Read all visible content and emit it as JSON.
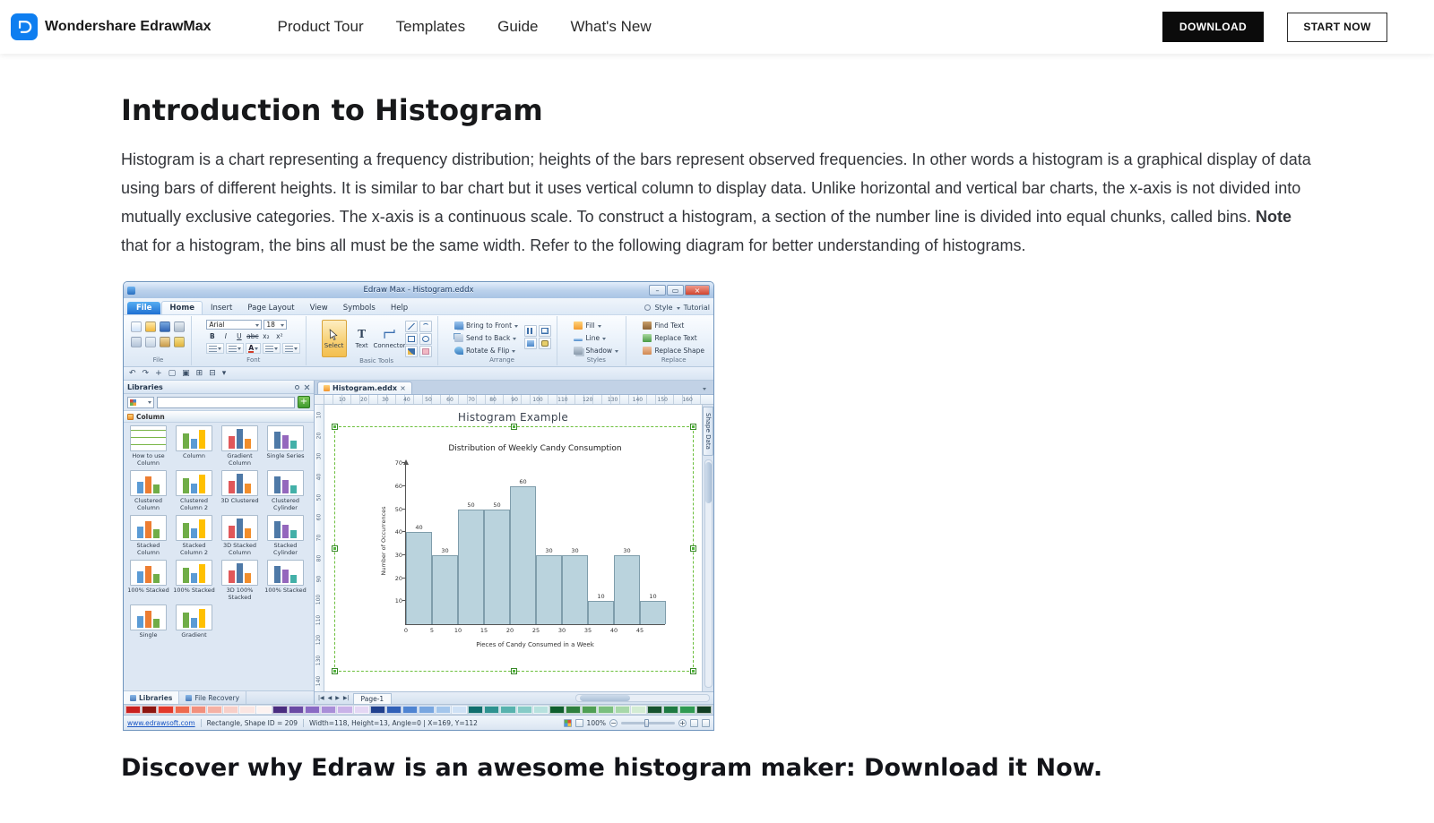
{
  "nav": {
    "brand": "Wondershare EdrawMax",
    "links": [
      "Product Tour",
      "Templates",
      "Guide",
      "What's New"
    ],
    "download_label": "DOWNLOAD",
    "start_label": "START NOW"
  },
  "article": {
    "title": "Introduction to Histogram",
    "p1": "Histogram is a chart representing a frequency distribution; heights of the bars represent observed frequencies. In other words a histogram is a graphical display of data using bars of different heights. It is similar to bar chart but it uses vertical column to display data. Unlike horizontal and vertical bar charts, the x-axis is not divided into mutually exclusive categories. The x-axis is a continuous scale. To construct a histogram, a section of the number line is divided into equal chunks, called bins. ",
    "note": "Note",
    "p2": " that for a histogram, the bins all must be the same width. Refer to the following diagram for better understanding of histograms.",
    "closing": "Discover why Edraw is an awesome histogram maker: Download it Now."
  },
  "app": {
    "window_title": "Edraw Max - Histogram.eddx",
    "window_controls": [
      "–",
      "▭",
      "×"
    ],
    "ribbon": {
      "tabs": [
        "File",
        "Home",
        "Insert",
        "Page Layout",
        "View",
        "Symbols",
        "Help"
      ],
      "active_tab": "Home",
      "right": [
        "Style",
        "Tutorial"
      ],
      "group_labels": [
        "File",
        "Font",
        "Basic Tools",
        "Arrange",
        "Styles",
        "Replace"
      ],
      "font_name": "Arial",
      "font_size": "18",
      "font_buttons": [
        "B",
        "I",
        "U",
        "abc",
        "x₂",
        "x²"
      ],
      "basic_tools": [
        "Select",
        "Text",
        "Connector"
      ],
      "text_tool_glyph": "T",
      "arrange_items": [
        "Bring to Front",
        "Send to Back",
        "Rotate & Flip"
      ],
      "style_items": [
        "Fill",
        "Line",
        "Shadow"
      ],
      "replace_items": [
        "Find Text",
        "Replace Text",
        "Replace Shape"
      ],
      "file_icons": [
        "new-icon",
        "open-icon",
        "save-icon",
        "print-icon",
        "cut-icon",
        "copy-icon",
        "paste-icon",
        "format-painter-icon"
      ],
      "font_row3_icons": [
        "numbered-list-icon",
        "highlight-icon",
        "font-color-icon",
        "align-text-icon",
        "bullet-list-icon"
      ],
      "basic_mini_icons": [
        "line-tool-icon",
        "curve-tool-icon",
        "rectangle-tool-icon",
        "ellipse-tool-icon",
        "pen-tool-icon",
        "eraser-tool-icon"
      ],
      "arrange_extra_icons": [
        "align-shapes-icon",
        "group-shapes-icon",
        "layer-icon",
        "lock-shape-icon"
      ]
    },
    "qat_icons": [
      {
        "name": "undo-icon",
        "glyph": "↶"
      },
      {
        "name": "redo-icon",
        "glyph": "↷"
      },
      {
        "name": "add-page-icon",
        "glyph": "+"
      },
      {
        "name": "page-icon",
        "glyph": "▢"
      },
      {
        "name": "duplicate-page-icon",
        "glyph": "▣"
      },
      {
        "name": "grid-icon",
        "glyph": "⊞"
      },
      {
        "name": "snap-icon",
        "glyph": "⊟"
      },
      {
        "name": "more-tools-icon",
        "glyph": "▾"
      }
    ],
    "left_panel": {
      "title": "Libraries",
      "section": "Column",
      "items": [
        "How to use Column",
        "Column",
        "Gradient Column",
        "Single Series",
        "Clustered Column",
        "Clustered Column 2",
        "3D Clustered",
        "Clustered Cylinder",
        "Stacked Column",
        "Stacked Column 2",
        "3D Stacked Column",
        "Stacked Cylinder",
        "100% Stacked",
        "100% Stacked",
        "3D 100% Stacked",
        "100% Stacked",
        "Single",
        "Gradient"
      ],
      "bottom_tabs": [
        "Libraries",
        "File Recovery"
      ]
    },
    "canvas": {
      "doc_tab": "Histogram.eddx",
      "page_title": "Histogram Example",
      "page_nav": [
        "|◀",
        "◀",
        "▶",
        "▶|"
      ],
      "page_tab": "Page-1",
      "shape_data_tab": "Shape Data",
      "h_ruler": [
        "10",
        "20",
        "30",
        "40",
        "50",
        "60",
        "70",
        "80",
        "90",
        "100",
        "110",
        "120",
        "130",
        "140",
        "150",
        "160"
      ],
      "v_ruler": [
        "10",
        "20",
        "30",
        "40",
        "50",
        "60",
        "70",
        "80",
        "90",
        "100",
        "110",
        "120",
        "130",
        "140"
      ]
    },
    "status": {
      "site": "www.edrawsoft.com",
      "shape_info": "Rectangle, Shape ID = 209",
      "metrics": "Width=118, Height=13, Angle=0 | X=169, Y=112",
      "zoom": "100%",
      "zoom_out": "−",
      "zoom_in": "+"
    }
  },
  "chart_data": {
    "type": "bar",
    "title": "Distribution of Weekly Candy Consumption",
    "xlabel": "Pieces of Candy Consumed in a Week",
    "ylabel": "Number of Occurrences",
    "bin_width": 5,
    "x_ticks": [
      0,
      5,
      10,
      15,
      20,
      25,
      30,
      35,
      40,
      45
    ],
    "y_ticks": [
      10,
      20,
      30,
      40,
      50,
      60,
      70
    ],
    "ylim": [
      0,
      70
    ],
    "values": [
      40,
      30,
      50,
      50,
      60,
      30,
      30,
      10,
      30,
      10
    ],
    "bar_color": "#bad3dd",
    "bar_border": "#7f9dab",
    "grid": false,
    "legend": false
  },
  "palette": [
    "#c9201f",
    "#8e1510",
    "#e2392b",
    "#ee6a4e",
    "#f28f7c",
    "#f5b1a4",
    "#f8cfc8",
    "#fbe6e2",
    "#fdf3f1",
    "#4a2d80",
    "#6a4aa4",
    "#8a6ac4",
    "#a98ed8",
    "#c9b2e8",
    "#e4d7f4",
    "#20408e",
    "#3060b8",
    "#4f84d2",
    "#78a6e0",
    "#a4c6ec",
    "#cfe1f5",
    "#106e6e",
    "#2e9290",
    "#57b2ae",
    "#86cbc7",
    "#b7e1de",
    "#0f5f2e",
    "#2e803e",
    "#4f9f54",
    "#7abf7e",
    "#a7d8a9",
    "#d3ecd3",
    "#17532f",
    "#1e7a42",
    "#2f9a52",
    "#123f24"
  ]
}
